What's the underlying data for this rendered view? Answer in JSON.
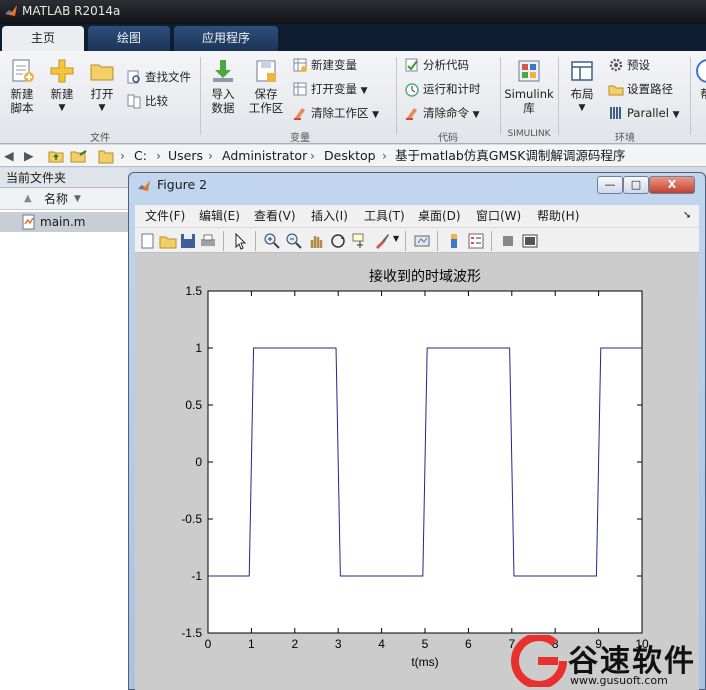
{
  "app": {
    "title": "MATLAB R2014a"
  },
  "tabs": [
    {
      "label": "主页",
      "active": true
    },
    {
      "label": "绘图",
      "active": false
    },
    {
      "label": "应用程序",
      "active": false
    }
  ],
  "ribbon": {
    "new_script": "新建\n脚本",
    "new": "新建",
    "open": "打开",
    "find_files": "查找文件",
    "compare": "比较",
    "import_data": "导入\n数据",
    "save_workspace": "保存\n工作区",
    "new_variable": "新建变量",
    "open_variable": "打开变量",
    "clear_workspace": "清除工作区",
    "analyze_code": "分析代码",
    "run_and_time": "运行和计时",
    "clear_commands": "清除命令",
    "simulink_library": "Simulink\n库",
    "layout": "布局",
    "preferences": "预设",
    "set_path": "设置路径",
    "parallel": "Parallel",
    "help": "帮",
    "groups": {
      "file": "文件",
      "variable": "变量",
      "code": "代码",
      "simulink": "SIMULINK",
      "environment": "环境"
    }
  },
  "address": {
    "crumbs": [
      "C:",
      "Users",
      "Administrator",
      "Desktop",
      "基于matlab仿真GMSK调制解调源码程序"
    ]
  },
  "current_folder": {
    "title": "当前文件夹",
    "name_header": "名称",
    "files": [
      "main.m"
    ]
  },
  "figure": {
    "title": "Figure 2",
    "buttons": {
      "minimize": "—",
      "maximize": "□",
      "close": "X"
    },
    "menus": [
      "文件(F)",
      "编辑(E)",
      "查看(V)",
      "插入(I)",
      "工具(T)",
      "桌面(D)",
      "窗口(W)",
      "帮助(H)"
    ],
    "toolbar_icons": [
      "new-figure-icon",
      "open-file-icon",
      "save-icon",
      "print-icon",
      "pointer-icon",
      "zoom-in-icon",
      "zoom-out-icon",
      "pan-hand-icon",
      "rotate-3d-icon",
      "data-cursor-icon",
      "brush-icon",
      "link-plot-icon",
      "colorbar-icon",
      "legend-icon",
      "hide-plot-tools-icon",
      "show-plot-tools-icon"
    ]
  },
  "watermark": {
    "text": "谷速软件",
    "url": "www.gusuoft.com"
  },
  "chart_data": {
    "type": "line",
    "title": "接收到的时域波形",
    "xlabel": "t(ms)",
    "ylabel": "",
    "xlim": [
      0,
      10
    ],
    "ylim": [
      -1.5,
      1.5
    ],
    "xticks": [
      "0",
      "1",
      "2",
      "3",
      "4",
      "5",
      "6",
      "7",
      "8",
      "9",
      "10"
    ],
    "yticks": [
      "-1.5",
      "-1",
      "-0.5",
      "0",
      "0.5",
      "1",
      "1.5"
    ],
    "grid": false,
    "series": [
      {
        "color": "#1f2a8a",
        "x": [
          0,
          0.95,
          1.05,
          2.95,
          3.05,
          4.95,
          5.05,
          6.95,
          7.05,
          8.95,
          9.05,
          10
        ],
        "y": [
          -1,
          -1,
          1,
          1,
          -1,
          -1,
          1,
          1,
          -1,
          -1,
          1,
          1
        ]
      }
    ]
  }
}
